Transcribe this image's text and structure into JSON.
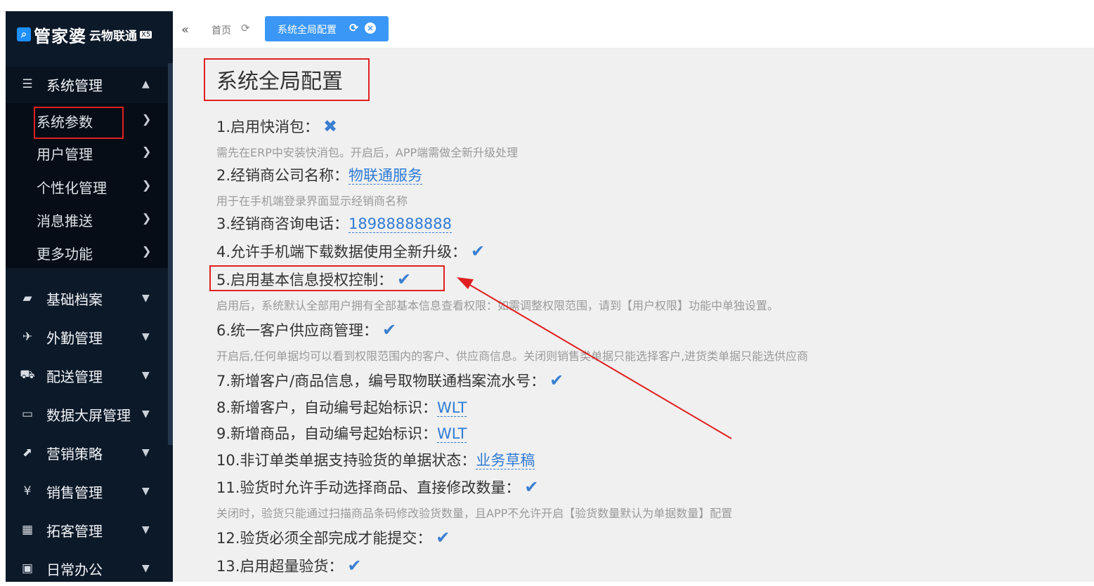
{
  "brand": {
    "logo_mark": "🔍",
    "name": "管家婆",
    "sub": "云物联通",
    "badge": "X5"
  },
  "sidebar": {
    "system_group": {
      "label": "系统管理",
      "icon": "sliders-icon"
    },
    "sub_items": [
      {
        "label": "系统参数"
      },
      {
        "label": "用户管理"
      },
      {
        "label": "个性化管理"
      },
      {
        "label": "消息推送"
      },
      {
        "label": "更多功能"
      }
    ],
    "groups": [
      {
        "label": "基础档案",
        "icon": "folder-icon"
      },
      {
        "label": "外勤管理",
        "icon": "plane-icon"
      },
      {
        "label": "配送管理",
        "icon": "truck-icon"
      },
      {
        "label": "数据大屏管理",
        "icon": "monitor-icon"
      },
      {
        "label": "营销策略",
        "icon": "share-icon"
      },
      {
        "label": "销售管理",
        "icon": "yen-icon"
      },
      {
        "label": "拓客管理",
        "icon": "grid-icon"
      },
      {
        "label": "日常办公",
        "icon": "briefcase-icon"
      }
    ]
  },
  "tabs": {
    "home": "首页",
    "active": "系统全局配置"
  },
  "page": {
    "title": "系统全局配置"
  },
  "config": [
    {
      "label": "1.启用快消包：",
      "state": "off",
      "desc": "需先在ERP中安装快消包。开启后，APP端需做全新升级处理"
    },
    {
      "label": "2.经销商公司名称：",
      "value": "物联通服务",
      "desc": "用于在手机端登录界面显示经销商名称"
    },
    {
      "label": "3.经销商咨询电话：",
      "value": "18988888888"
    },
    {
      "label": "4.允许手机端下载数据使用全新升级：",
      "state": "on"
    },
    {
      "label": "5.启用基本信息授权控制：",
      "state": "on",
      "desc": "启用后，系统默认全部用户拥有全部基本信息查看权限：如需调整权限范围，请到【用户权限】功能中单独设置。"
    },
    {
      "label": "6.统一客户供应商管理：",
      "state": "on",
      "desc": "开启后,任何单据均可以看到权限范围内的客户、供应商信息。关闭则销售类单据只能选择客户,进货类单据只能选供应商"
    },
    {
      "label": "7.新增客户/商品信息，编号取物联通档案流水号：",
      "state": "on"
    },
    {
      "label": "8.新增客户，自动编号起始标识：",
      "value": "WLT"
    },
    {
      "label": "9.新增商品，自动编号起始标识：",
      "value": "WLT"
    },
    {
      "label": "10.非订单类单据支持验货的单据状态：",
      "value": "业务草稿"
    },
    {
      "label": "11.验货时允许手动选择商品、直接修改数量：",
      "state": "on",
      "desc": "关闭时，验货只能通过扫描商品条码修改验货数量，且APP不允许开启【验货数量默认为单据数量】配置"
    },
    {
      "label": "12.验货必须全部完成才能提交：",
      "state": "on"
    },
    {
      "label": "13.启用超量验货：",
      "state": "on"
    }
  ],
  "glyphs": {
    "check": "✔",
    "cross": "✖",
    "chevron_right": "›",
    "chevron_up": "⌃",
    "chevron_down": "⌄",
    "collapse": "«",
    "refresh": "⟳",
    "close": "×"
  },
  "colors": {
    "sidebar_bg": "#0c1929",
    "accent": "#3a97f6",
    "check": "#3a7fd0",
    "highlight": "#e02020"
  }
}
